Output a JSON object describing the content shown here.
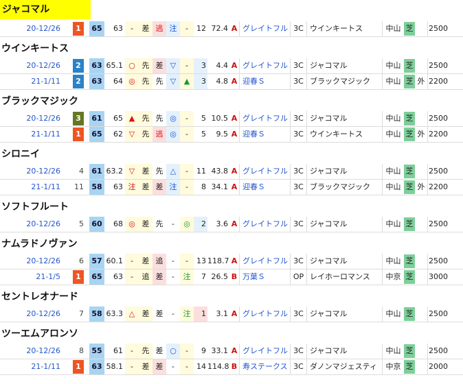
{
  "horses": [
    {
      "name": "ジャコマル",
      "highlight": true,
      "races": [
        {
          "date": "20-12/26",
          "pos": "1",
          "pos_class": "pos-1",
          "idx": "65",
          "idx2": "63",
          "m1": "-",
          "m2": "差",
          "m3": "逃",
          "m3c": "red",
          "m3bg": "bg-p",
          "m4": "注",
          "m4c": "blue",
          "m4bg": "bg-b",
          "m5": "-",
          "m5bg": "bg-y",
          "pop": "12",
          "odds": "72.4",
          "cls": "A",
          "race": "グレイトフル",
          "grade": "3C",
          "winner": "ウインキートス",
          "track": "中山",
          "surface": "芝",
          "io": "",
          "dist": "2500"
        }
      ]
    },
    {
      "name": "ウインキートス",
      "races": [
        {
          "date": "20-12/26",
          "pos": "2",
          "pos_class": "pos-2",
          "idx": "63",
          "idx2": "65.1",
          "m1": "○",
          "m1c": "red",
          "m2": "先",
          "m3": "差",
          "m3c": "",
          "m3bg": "bg-p",
          "m4": "▽",
          "m4c": "blue",
          "m4bg": "bg-b",
          "m5": "-",
          "m5bg": "",
          "pop": "3",
          "popbg": "bg-b",
          "odds": "4.4",
          "cls": "A",
          "race": "グレイトフル",
          "grade": "3C",
          "winner": "ジャコマル",
          "track": "中山",
          "surface": "芝",
          "io": "",
          "dist": "2500"
        },
        {
          "date": "21-1/11",
          "pos": "2",
          "pos_class": "pos-2",
          "idx": "63",
          "idx2": "64",
          "m1": "◎",
          "m1c": "red",
          "m2": "先",
          "m3": "先",
          "m3c": "",
          "m3bg": "",
          "m4": "▽",
          "m4c": "blue",
          "m4bg": "bg-b",
          "m5": "▲",
          "m5c": "green",
          "m5bg": "",
          "pop": "3",
          "popbg": "bg-b",
          "odds": "4.8",
          "cls": "A",
          "race": "迎春Ｓ",
          "grade": "3C",
          "winner": "ブラックマジック",
          "track": "中山",
          "surface": "芝",
          "io": "外",
          "dist": "2200"
        }
      ]
    },
    {
      "name": "ブラックマジック",
      "races": [
        {
          "date": "20-12/26",
          "pos": "3",
          "pos_class": "pos-3",
          "idx": "61",
          "idx2": "65",
          "m1": "▲",
          "m1c": "red",
          "m2": "先",
          "m3": "先",
          "m3c": "",
          "m3bg": "",
          "m4": "◎",
          "m4c": "blue",
          "m4bg": "bg-b",
          "m5": "-",
          "m5bg": "",
          "pop": "5",
          "odds": "10.5",
          "cls": "A",
          "race": "グレイトフル",
          "grade": "3C",
          "winner": "ジャコマル",
          "track": "中山",
          "surface": "芝",
          "io": "",
          "dist": "2500"
        },
        {
          "date": "21-1/11",
          "pos": "1",
          "pos_class": "pos-1",
          "idx": "65",
          "idx2": "62",
          "m1": "▽",
          "m1c": "red",
          "m2": "先",
          "m3": "逃",
          "m3c": "red",
          "m3bg": "bg-p",
          "m4": "◎",
          "m4c": "blue",
          "m4bg": "bg-b",
          "m5": "-",
          "m5bg": "",
          "pop": "5",
          "odds": "9.5",
          "cls": "A",
          "race": "迎春Ｓ",
          "grade": "3C",
          "winner": "ウインキートス",
          "track": "中山",
          "surface": "芝",
          "io": "外",
          "dist": "2200"
        }
      ]
    },
    {
      "name": "シロニイ",
      "races": [
        {
          "date": "20-12/26",
          "pos": "4",
          "pos_class": "",
          "idx": "61",
          "idx2": "63.2",
          "m1": "▽",
          "m1c": "red",
          "m2": "差",
          "m3": "先",
          "m3c": "",
          "m3bg": "",
          "m4": "△",
          "m4c": "blue",
          "m4bg": "bg-b",
          "m5": "-",
          "m5bg": "",
          "pop": "11",
          "odds": "43.8",
          "cls": "A",
          "race": "グレイトフル",
          "grade": "3C",
          "winner": "ジャコマル",
          "track": "中山",
          "surface": "芝",
          "io": "",
          "dist": "2500"
        },
        {
          "date": "21-1/11",
          "pos": "11",
          "pos_class": "",
          "idx": "58",
          "idx2": "63",
          "m1": "注",
          "m1c": "red",
          "m2": "差",
          "m3": "差",
          "m3c": "",
          "m3bg": "bg-p",
          "m4": "注",
          "m4c": "blue",
          "m4bg": "bg-b",
          "m5": "-",
          "m5bg": "",
          "pop": "8",
          "odds": "34.1",
          "cls": "A",
          "race": "迎春Ｓ",
          "grade": "3C",
          "winner": "ブラックマジック",
          "track": "中山",
          "surface": "芝",
          "io": "外",
          "dist": "2200"
        }
      ]
    },
    {
      "name": "ソフトフルート",
      "races": [
        {
          "date": "20-12/26",
          "pos": "5",
          "pos_class": "",
          "idx": "60",
          "idx2": "68",
          "m1": "◎",
          "m1c": "red",
          "m2": "差",
          "m3": "先",
          "m3c": "",
          "m3bg": "",
          "m4": "-",
          "m4c": "",
          "m4bg": "",
          "m5": "◎",
          "m5c": "green",
          "m5bg": "",
          "pop": "2",
          "popbg": "bg-b",
          "odds": "3.6",
          "cls": "A",
          "race": "グレイトフル",
          "grade": "3C",
          "winner": "ジャコマル",
          "track": "中山",
          "surface": "芝",
          "io": "",
          "dist": "2500"
        }
      ]
    },
    {
      "name": "ナムラドノヴァン",
      "races": [
        {
          "date": "20-12/26",
          "pos": "6",
          "pos_class": "",
          "idx": "57",
          "idx2": "60.1",
          "m1": "-",
          "m1c": "",
          "m2": "差",
          "m3": "追",
          "m3c": "",
          "m3bg": "bg-p",
          "m4": "-",
          "m4c": "",
          "m4bg": "",
          "m5": "-",
          "m5bg": "",
          "pop": "13",
          "odds": "118.7",
          "cls": "A",
          "race": "グレイトフル",
          "grade": "3C",
          "winner": "ジャコマル",
          "track": "中山",
          "surface": "芝",
          "io": "",
          "dist": "2500"
        },
        {
          "date": "21-1/5",
          "pos": "1",
          "pos_class": "pos-1",
          "idx": "65",
          "idx2": "63",
          "m1": "-",
          "m1c": "",
          "m2": "追",
          "m3": "差",
          "m3c": "",
          "m3bg": "bg-p",
          "m4": "-",
          "m4c": "",
          "m4bg": "",
          "m5": "注",
          "m5c": "green",
          "m5bg": "",
          "pop": "7",
          "odds": "26.5",
          "cls": "B",
          "race": "万葉Ｓ",
          "grade": "OP",
          "winner": "レイホーロマンス",
          "track": "中京",
          "surface": "芝",
          "io": "",
          "dist": "3000"
        }
      ]
    },
    {
      "name": "セントレオナード",
      "races": [
        {
          "date": "20-12/26",
          "pos": "7",
          "pos_class": "",
          "idx": "58",
          "idx2": "63.3",
          "m1": "△",
          "m1c": "red",
          "m2": "差",
          "m3": "差",
          "m3c": "",
          "m3bg": "",
          "m4": "-",
          "m4c": "",
          "m4bg": "",
          "m5": "注",
          "m5c": "green",
          "m5bg": "",
          "pop": "1",
          "popbg": "bg-p",
          "odds": "3.1",
          "cls": "A",
          "race": "グレイトフル",
          "grade": "3C",
          "winner": "ジャコマル",
          "track": "中山",
          "surface": "芝",
          "io": "",
          "dist": "2500"
        }
      ]
    },
    {
      "name": "ツーエムアロンソ",
      "races": [
        {
          "date": "20-12/26",
          "pos": "8",
          "pos_class": "",
          "idx": "55",
          "idx2": "61",
          "m1": "-",
          "m1c": "",
          "m2": "先",
          "m3": "差",
          "m3c": "",
          "m3bg": "",
          "m4": "○",
          "m4c": "blue",
          "m4bg": "bg-b",
          "m5": "-",
          "m5bg": "",
          "pop": "9",
          "odds": "33.1",
          "cls": "A",
          "race": "グレイトフル",
          "grade": "3C",
          "winner": "ジャコマル",
          "track": "中山",
          "surface": "芝",
          "io": "",
          "dist": "2500"
        },
        {
          "date": "21-1/11",
          "pos": "1",
          "pos_class": "pos-1",
          "idx": "63",
          "idx2": "58.1",
          "m1": "-",
          "m1c": "",
          "m2": "差",
          "m3": "差",
          "m3c": "",
          "m3bg": "bg-p",
          "m4": "-",
          "m4c": "",
          "m4bg": "",
          "m5": "-",
          "m5bg": "",
          "pop": "14",
          "odds": "114.8",
          "cls": "B",
          "race": "寿ステークス",
          "grade": "3C",
          "winner": "ダノンマジェスティ",
          "track": "中京",
          "surface": "芝",
          "io": "",
          "dist": "2000"
        }
      ]
    }
  ]
}
